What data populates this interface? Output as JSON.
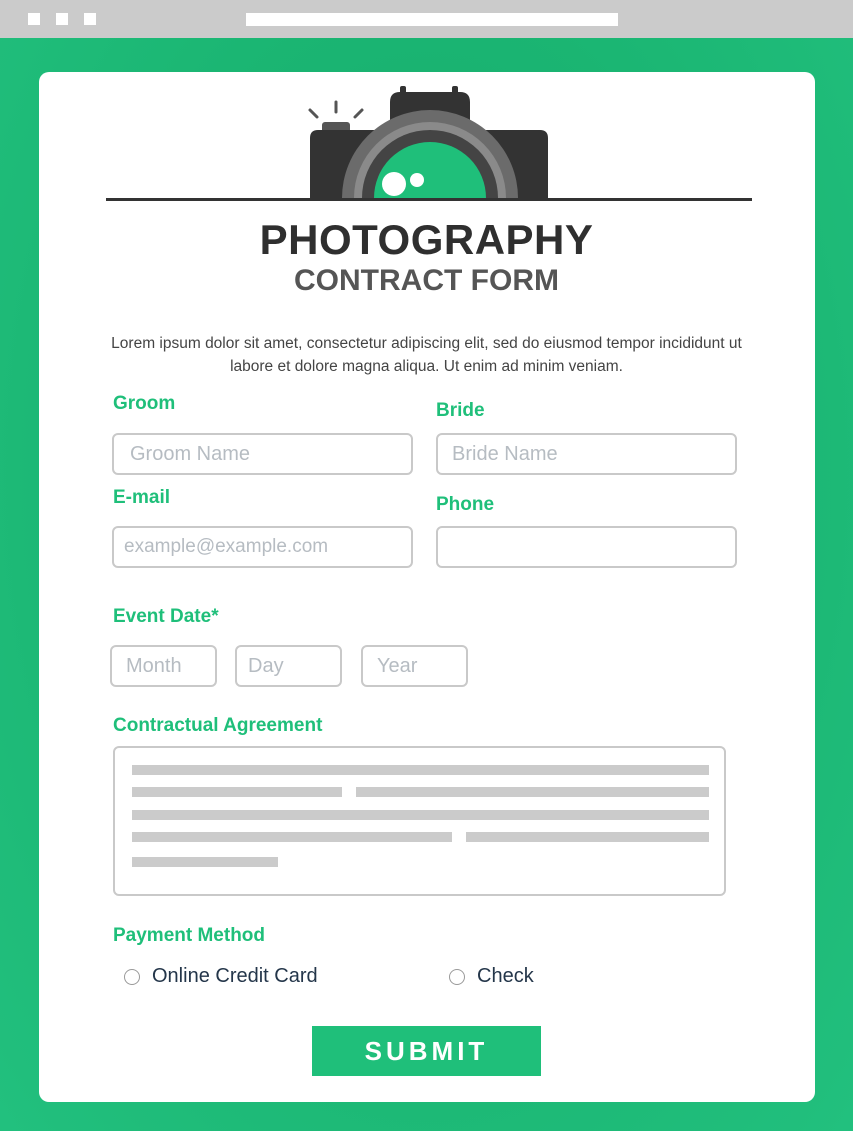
{
  "colors": {
    "accent": "#1fbf7a",
    "chrome": "#cbcbcb",
    "dark": "#2f2f2f"
  },
  "header": {
    "title": "PHOTOGRAPHY",
    "subtitle": "CONTRACT FORM",
    "intro": "Lorem ipsum dolor sit amet, consectetur adipiscing elit, sed do eiusmod tempor incididunt ut labore et dolore magna aliqua. Ut enim ad minim veniam.",
    "icon": "camera-icon"
  },
  "form": {
    "groom": {
      "label": "Groom",
      "placeholder": "Groom Name"
    },
    "bride": {
      "label": "Bride",
      "placeholder": "Bride Name"
    },
    "email": {
      "label": "E-mail",
      "placeholder": "example@example.com"
    },
    "phone": {
      "label": "Phone",
      "placeholder": ""
    },
    "event_date": {
      "label": "Event Date*",
      "month": "Month",
      "day": "Day",
      "year": "Year"
    },
    "agreement": {
      "label": "Contractual Agreement"
    },
    "payment": {
      "label": "Payment Method",
      "options": [
        {
          "label": "Online Credit Card",
          "selected": false
        },
        {
          "label": "Check",
          "selected": false
        }
      ]
    },
    "submit_label": "SUBMIT"
  }
}
